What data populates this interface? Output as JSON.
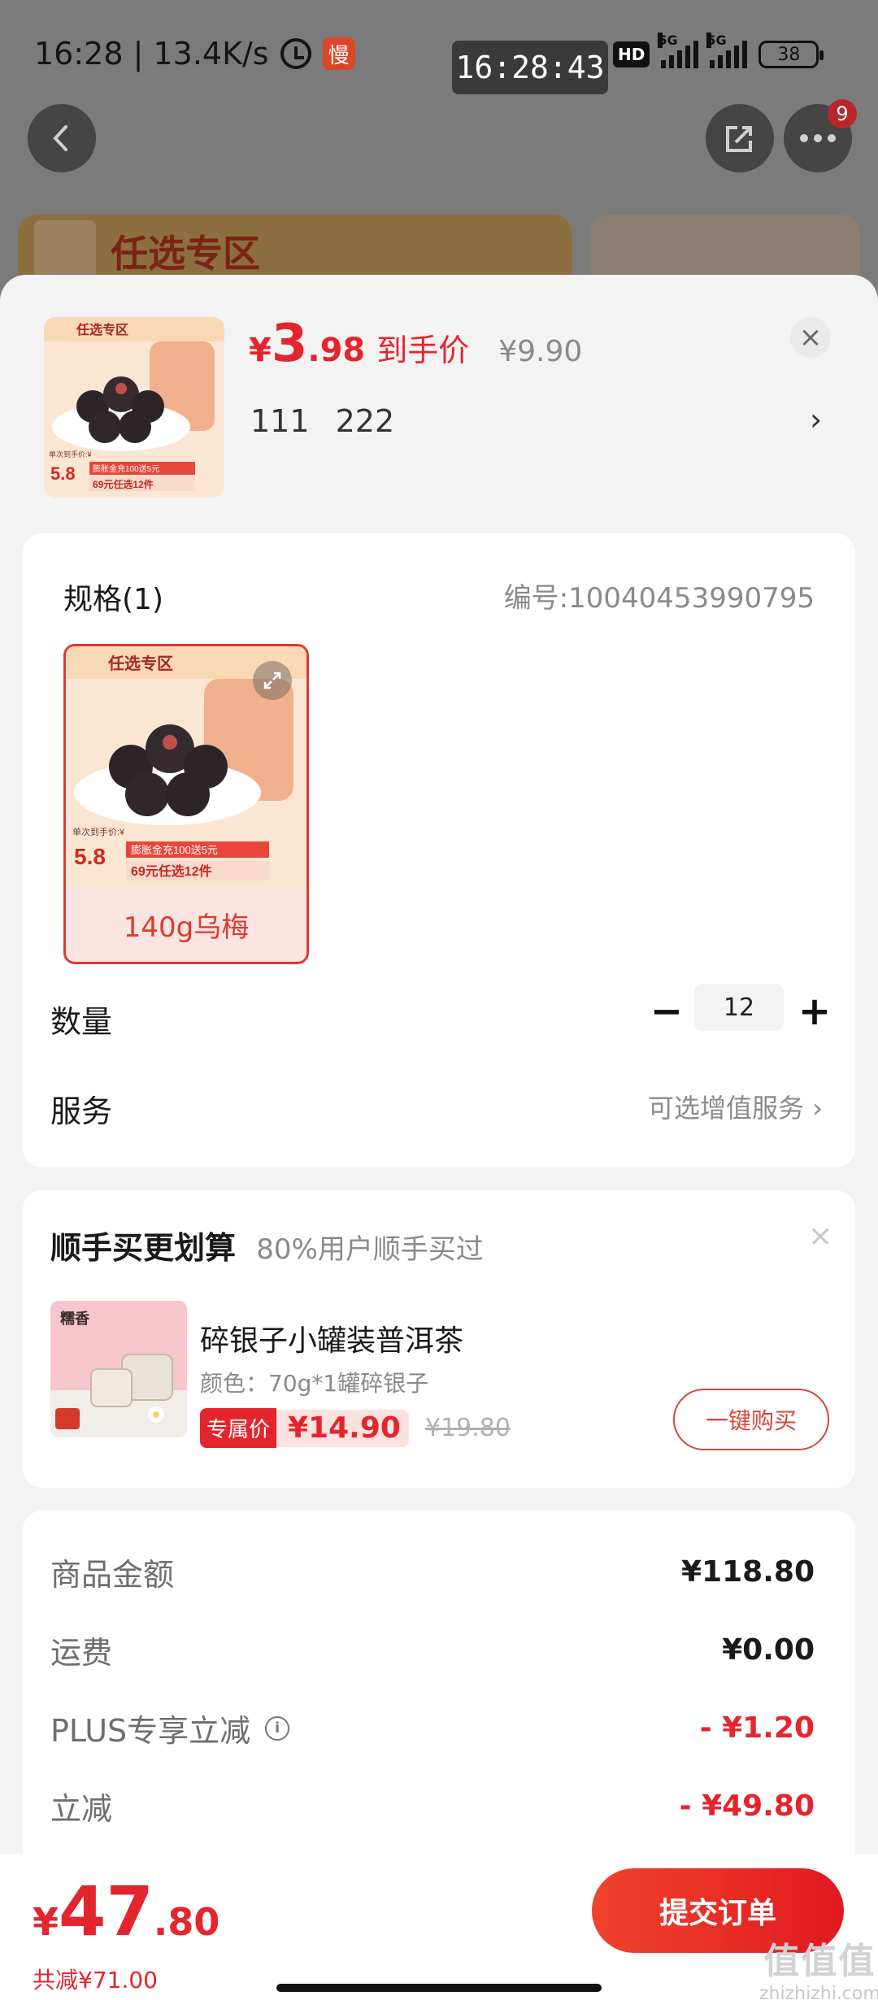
{
  "status_bar": {
    "time_speed": "16:28 | 13.4K/s",
    "slow_badge": "慢",
    "clock_overlay": "16:28:43",
    "hd": "HD",
    "net1": "5G",
    "net2": "5G",
    "battery": "38"
  },
  "background": {
    "banner_text": "任选专区",
    "notification_count": "9",
    "back_icon": "chevron-left",
    "share_icon": "share",
    "more_icon": "ellipsis"
  },
  "product": {
    "price_yen": "¥",
    "price_int": "3",
    "price_dec": ".98",
    "price_label": "到手价",
    "orig_price": "¥9.90",
    "attrs": "111 222",
    "close_icon": "×",
    "chevron": "›",
    "thumb_texts": {
      "zone": "任选专区",
      "price_prefix": "单次到手价:¥",
      "price": "5.8",
      "promo1": "膨胀金充100送5元",
      "promo2": "69元任选12件"
    }
  },
  "spec": {
    "title": "规格(1)",
    "sku_no": "编号:10040453990795",
    "option_label": "140g乌梅",
    "expand_icon": "expand"
  },
  "quantity": {
    "label": "数量",
    "minus": "−",
    "plus": "+",
    "value": "12"
  },
  "service": {
    "label": "服务",
    "value": "可选增值服务 ›"
  },
  "upsell": {
    "title": "顺手买更划算",
    "subtitle": "80%用户顺手买过",
    "close": "×",
    "name": "碎银子小罐装普洱茶",
    "color": "颜色：70g*1罐碎银子",
    "tag": "专属价",
    "price": "¥14.90",
    "orig_price": "¥19.80",
    "buy_button": "一键购买",
    "thumb_text": "糯香"
  },
  "summary": {
    "rows": [
      {
        "label": "商品金额",
        "value": "¥118.80"
      },
      {
        "label": "运费",
        "value": "¥0.00"
      },
      {
        "label": "PLUS专享立减",
        "value": "- ¥1.20"
      },
      {
        "label": "立减",
        "value": "- ¥49.80"
      }
    ]
  },
  "bottom": {
    "total_yen": "¥",
    "total_int": "47",
    "total_dec": ".80",
    "saved": "共减¥71.00",
    "submit": "提交订单",
    "watermark_top": "值值值",
    "watermark_bottom": "zhizhizhi.com"
  },
  "colors": {
    "accent_red": "#e4252d",
    "overlay_gray": "#7b7b7b",
    "sheet_bg": "#f3f3f3"
  }
}
